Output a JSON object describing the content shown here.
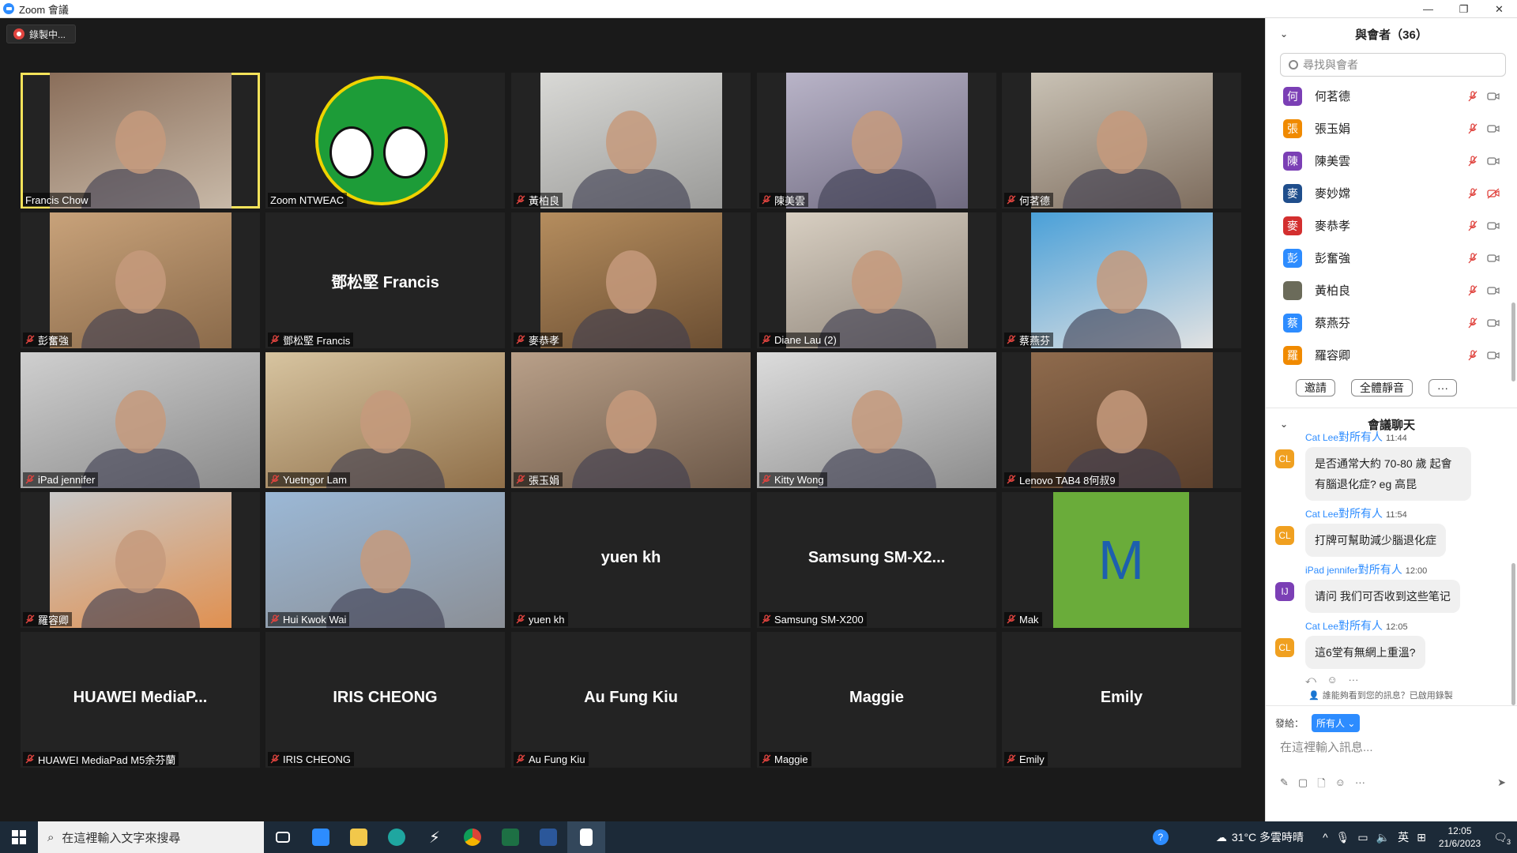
{
  "window": {
    "title": "Zoom 會議",
    "controls": [
      "—",
      "❐",
      "✕"
    ]
  },
  "recording": {
    "label": "錄製中..."
  },
  "tiles": [
    {
      "id": "francis-chow",
      "label": "Francis Chow",
      "muted": false,
      "type": "video",
      "active": true
    },
    {
      "id": "zoom-ntweac",
      "label": "Zoom NTWEAC",
      "muted": false,
      "type": "logo"
    },
    {
      "id": "wong-pak-leung",
      "label": "黃柏良",
      "muted": true,
      "type": "video"
    },
    {
      "id": "chan-mei-wan",
      "label": "陳美雲",
      "muted": true,
      "type": "video"
    },
    {
      "id": "ho-ming-tak",
      "label": "何茗德",
      "muted": true,
      "type": "video"
    },
    {
      "id": "pang-fan-keung",
      "label": "彭奮強",
      "muted": true,
      "type": "video"
    },
    {
      "id": "tang-chung-kin",
      "label": "鄧松堅 Francis",
      "muted": true,
      "type": "name",
      "bigname": "鄧松堅 Francis"
    },
    {
      "id": "mak-kung-hau",
      "label": "麥恭孝",
      "muted": true,
      "type": "video"
    },
    {
      "id": "diane-lau",
      "label": "Diane Lau (2)",
      "muted": true,
      "type": "video"
    },
    {
      "id": "choi-yin-fun",
      "label": "蔡燕芬",
      "muted": true,
      "type": "video"
    },
    {
      "id": "ipad-jennifer",
      "label": "iPad jennifer",
      "muted": true,
      "type": "video"
    },
    {
      "id": "yuetngor-lam",
      "label": "Yuetngor Lam",
      "muted": true,
      "type": "video"
    },
    {
      "id": "cheung-yuk-kuen",
      "label": "張玉娟",
      "muted": true,
      "type": "video"
    },
    {
      "id": "kitty-wong",
      "label": "Kitty Wong",
      "muted": true,
      "type": "video"
    },
    {
      "id": "lenovo-tab4",
      "label": "Lenovo TAB4 8何叔9",
      "muted": true,
      "type": "video"
    },
    {
      "id": "law-yung-hing",
      "label": "羅容卿",
      "muted": true,
      "type": "video"
    },
    {
      "id": "hui-kwok-wai",
      "label": "Hui Kwok Wai",
      "muted": true,
      "type": "video"
    },
    {
      "id": "yuen-kh",
      "label": "yuen kh",
      "muted": true,
      "type": "name",
      "bigname": "yuen kh"
    },
    {
      "id": "samsung",
      "label": "Samsung SM-X200",
      "muted": true,
      "type": "name",
      "bigname": "Samsung  SM-X2..."
    },
    {
      "id": "mak",
      "label": "Mak",
      "muted": true,
      "type": "avatar",
      "letter": "M"
    },
    {
      "id": "huawei",
      "label": "HUAWEI MediaPad M5余芬蘭",
      "muted": true,
      "type": "name",
      "bigname": "HUAWEI  MediaP..."
    },
    {
      "id": "iris-cheong",
      "label": "IRIS CHEONG",
      "muted": true,
      "type": "name",
      "bigname": "IRIS CHEONG"
    },
    {
      "id": "au-fung-kiu",
      "label": "Au Fung Kiu",
      "muted": true,
      "type": "name",
      "bigname": "Au Fung Kiu"
    },
    {
      "id": "maggie",
      "label": "Maggie",
      "muted": true,
      "type": "name",
      "bigname": "Maggie"
    },
    {
      "id": "emily",
      "label": "Emily",
      "muted": true,
      "type": "name",
      "bigname": "Emily"
    }
  ],
  "participants": {
    "title": "與會者（36）",
    "search_placeholder": "尋找與會者",
    "list": [
      {
        "initial": "何",
        "name": "何茗德",
        "color": "#7b3fb5",
        "video_off": false
      },
      {
        "initial": "張",
        "name": "張玉娟",
        "color": "#f08a00",
        "video_off": false
      },
      {
        "initial": "陳",
        "name": "陳美雲",
        "color": "#7b3fb5",
        "video_off": false
      },
      {
        "initial": "麥",
        "name": "麥妙嫦",
        "color": "#1f4e8c",
        "video_off": true
      },
      {
        "initial": "麥",
        "name": "麥恭孝",
        "color": "#d32f2f",
        "video_off": false
      },
      {
        "initial": "彭",
        "name": "彭奮強",
        "color": "#2d8cff",
        "video_off": false
      },
      {
        "initial": "",
        "name": "黃柏良",
        "color": "#6b6b5a",
        "video_off": false
      },
      {
        "initial": "蔡",
        "name": "蔡燕芬",
        "color": "#2d8cff",
        "video_off": false
      },
      {
        "initial": "羅",
        "name": "羅容卿",
        "color": "#f08a00",
        "video_off": false
      }
    ],
    "invite_label": "邀請",
    "mute_all_label": "全體靜音",
    "more_label": "···"
  },
  "chat": {
    "title": "會議聊天",
    "messages": [
      {
        "initials": "CL",
        "color": "#f0a020",
        "sender": "Cat Lee",
        "to": "對所有人",
        "time": "11:44",
        "text": "是否通常大約 70-80 歲 起會有腦退化症? eg 高昆"
      },
      {
        "initials": "CL",
        "color": "#f0a020",
        "sender": "Cat Lee",
        "to": "對所有人",
        "time": "11:54",
        "text": "打牌可幫助減少腦退化症"
      },
      {
        "initials": "IJ",
        "color": "#7b3fb5",
        "sender": "iPad jennifer",
        "to": "對所有人",
        "time": "12:00",
        "text": "请问 我们可否收到这些笔记"
      },
      {
        "initials": "CL",
        "color": "#f0a020",
        "sender": "Cat Lee",
        "to": "對所有人",
        "time": "12:05",
        "text": "這6堂有無網上重溫?"
      }
    ],
    "notice": "誰能夠看到您的訊息？已啟用錄製",
    "send_to_label": "發給：",
    "send_to_value": "所有人",
    "input_placeholder": "在這裡輸入訊息..."
  },
  "taskbar": {
    "search_placeholder": "在這裡輸入文字來搜尋",
    "weather": "31°C  多雲時晴",
    "ime": "英",
    "time": "12:05",
    "date": "21/6/2023",
    "notifications": "3"
  }
}
